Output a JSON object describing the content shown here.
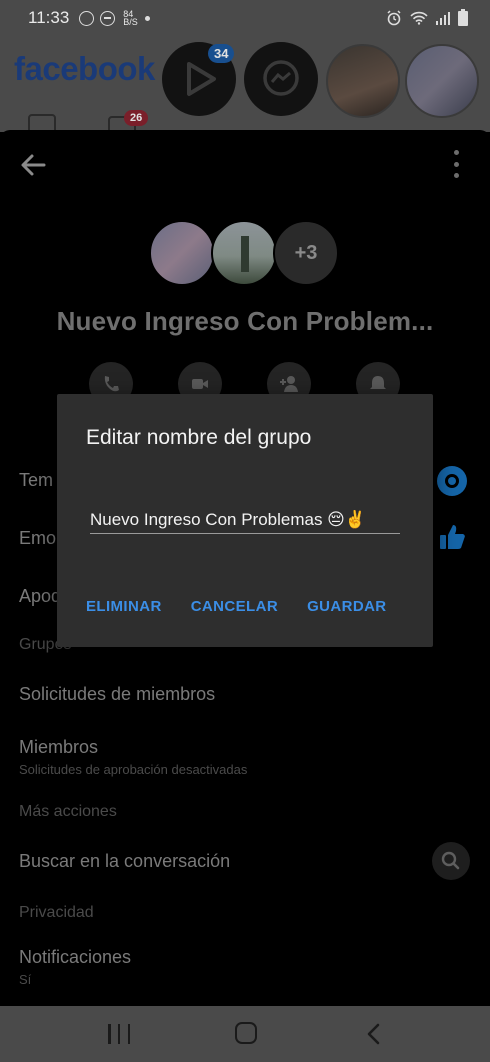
{
  "status_bar": {
    "time": "11:33",
    "data_indicator": "84 B/S"
  },
  "fb_header": {
    "logo": "facebook",
    "watch_badge": "34",
    "video_badge": "26"
  },
  "chat_settings": {
    "group_name": "Nuevo Ingreso Con Problem...",
    "extra_members": "+3",
    "rows": {
      "theme": "Tem",
      "emoji": "Emo",
      "nicknames": "Apod",
      "groups_section": "Grupos",
      "member_requests": "Solicitudes de miembros",
      "members": "Miembros",
      "members_sub": "Solicitudes de aprobación desactivadas",
      "more_actions_section": "Más acciones",
      "search_conversation": "Buscar en la conversación",
      "privacy_section": "Privacidad",
      "notifications": "Notificaciones",
      "notifications_sub": "Sí"
    }
  },
  "dialog": {
    "title": "Editar nombre del grupo",
    "input_value": "Nuevo Ingreso Con Problemas 😔✌️",
    "delete_label": "ELIMINAR",
    "cancel_label": "CANCELAR",
    "save_label": "GUARDAR"
  },
  "colors": {
    "accent": "#3b8ee6",
    "dialog_bg": "#2e2e2e"
  }
}
